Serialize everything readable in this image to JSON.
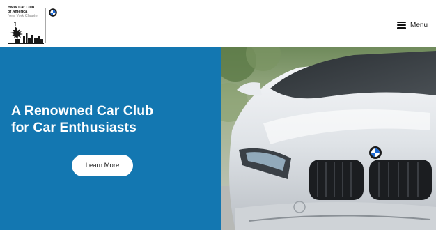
{
  "header": {
    "logo": {
      "line1": "BMW Car Club",
      "line2": "of America",
      "line3": "New York Chapter"
    },
    "menu_label": "Menu"
  },
  "hero": {
    "title_line1": "A Renowned Car Club",
    "title_line2": "for Car Enthusiasts",
    "button_label": "Learn More"
  },
  "colors": {
    "hero_blue": "#1377b1",
    "header_bg": "#ffffff",
    "text_dark": "#1b1b1b"
  },
  "icons": [
    "bmw-roundel-icon",
    "statue-of-liberty-icon",
    "hamburger-menu-icon"
  ]
}
